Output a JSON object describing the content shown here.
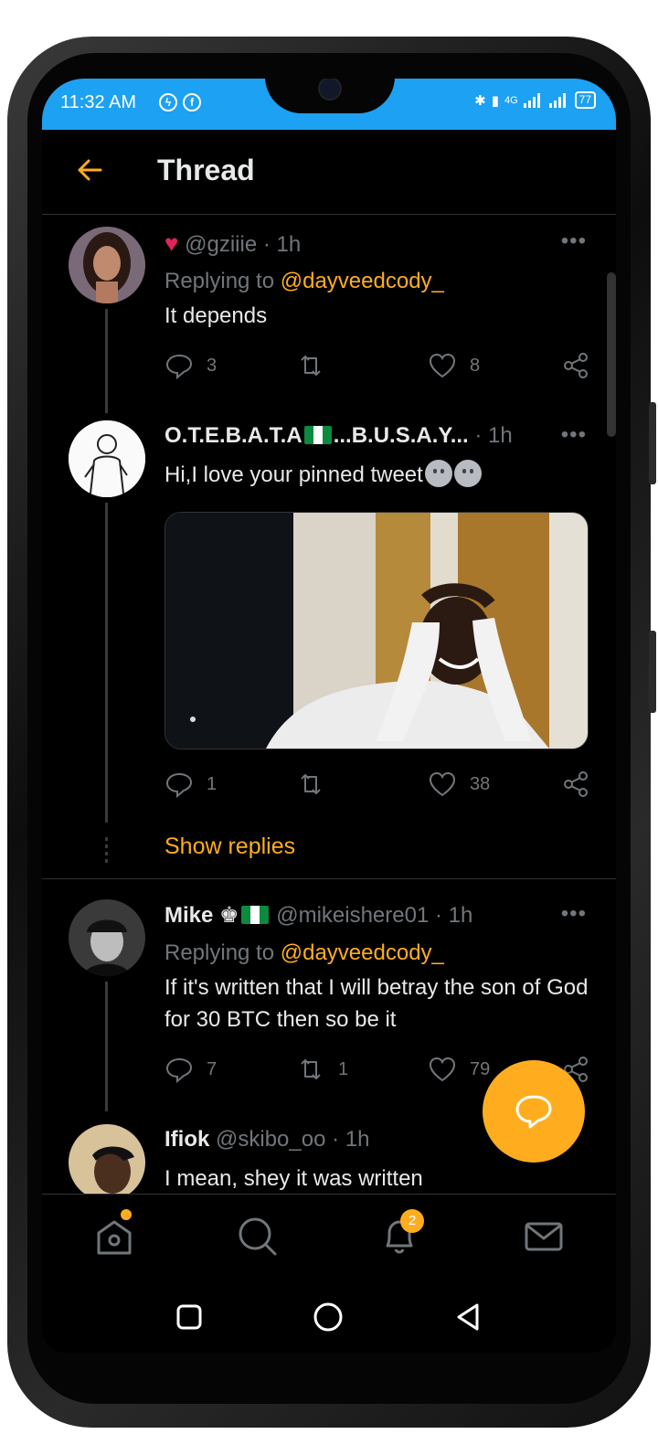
{
  "status_bar": {
    "time": "11:32 AM",
    "battery": "77",
    "network": "4G"
  },
  "header": {
    "title": "Thread"
  },
  "tweets": [
    {
      "display_name": "",
      "handle": "@gziiie",
      "time": "· 1h",
      "replying_prefix": "Replying to",
      "replying_to": "@dayveedcody_",
      "text": "It depends",
      "replies": "3",
      "retweets": "",
      "likes": "8"
    },
    {
      "display_name": "O.T.E.B.A.T.A",
      "display_name_tail": "...B.U.S.A.Y...",
      "handle": "",
      "time": "· 1h",
      "text": "Hi,I love your pinned tweet",
      "replies": "1",
      "retweets": "",
      "likes": "38"
    },
    {
      "display_name": "Mike",
      "handle": "@mikeishere01",
      "time": "· 1h",
      "replying_prefix": "Replying to",
      "replying_to": "@dayveedcody_",
      "text": "If it's written that I will betray the son of God for 30 BTC then so be it",
      "replies": "7",
      "retweets": "1",
      "likes": "79"
    },
    {
      "display_name": "Ifiok",
      "handle": "@skibo_oo",
      "time": "· 1h",
      "text": "I mean, shey it was written"
    }
  ],
  "show_replies": "Show replies",
  "bottom_nav": {
    "notifications_badge": "2"
  },
  "colors": {
    "accent": "#ffad1f",
    "status_bar": "#1da1f2",
    "background": "#000000"
  }
}
